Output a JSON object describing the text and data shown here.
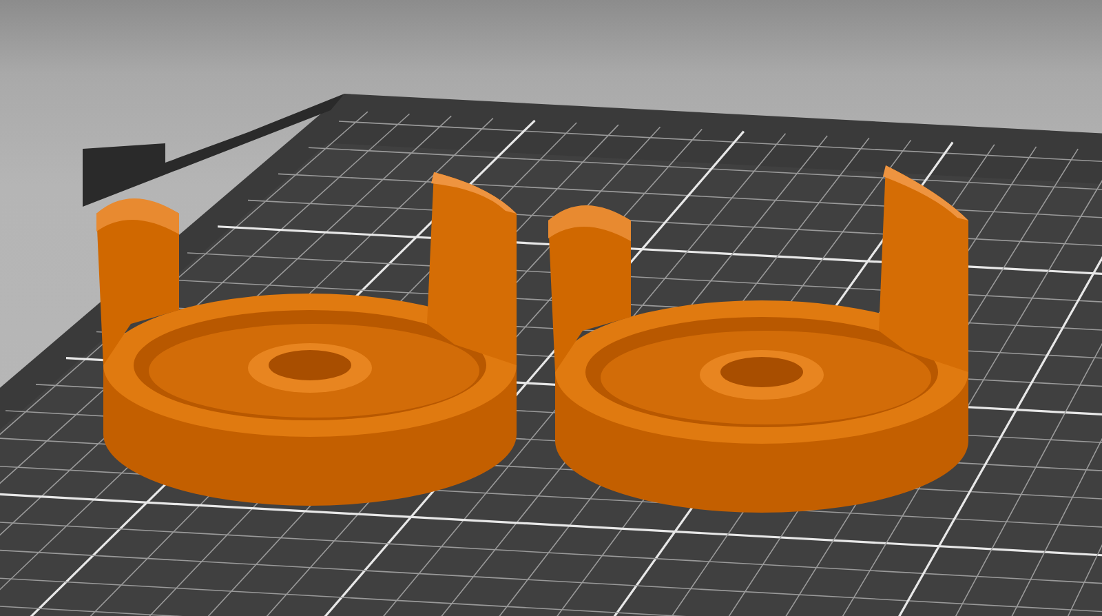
{
  "viewport": {
    "models": [
      {
        "kind": "cup"
      },
      {
        "kind": "cup"
      }
    ]
  }
}
